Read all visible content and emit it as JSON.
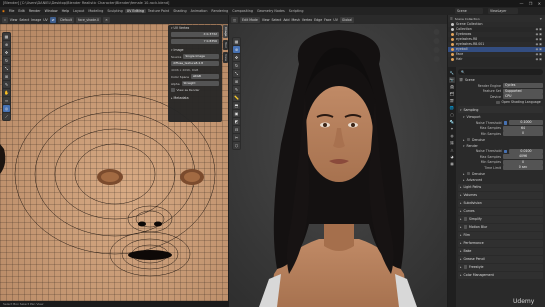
{
  "title_bar": {
    "text": "[Blender] [C:\\Users\\DANIEL\\Desktop\\Blender Realistic Character\\Blender\\female 10-rock.blend]",
    "window_controls": "—  ❐  ✕"
  },
  "menubar": {
    "app_menus": [
      "File",
      "Edit",
      "Render",
      "Window",
      "Help"
    ],
    "workspaces": [
      "Layout",
      "Modeling",
      "Sculpting",
      "UV Editing",
      "Texture Paint",
      "Shading",
      "Animation",
      "Rendering",
      "Compositing",
      "Geometry Nodes",
      "Scripting"
    ],
    "active_workspace": "UV Editing",
    "scene_name": "Scene",
    "view_layer": "ViewLayer"
  },
  "uv_editor": {
    "header_items": [
      "UV Editor",
      "View",
      "Select",
      "Image",
      "UV"
    ],
    "image_name": "face_shade.0",
    "sync_label": "Default",
    "toolbar_icons": [
      "cursor-icon",
      "move-icon",
      "rotate-icon",
      "scale-icon",
      "transform-icon",
      "annotate-icon",
      "grab-icon",
      "relax-icon",
      "pinch-icon",
      "rip-icon"
    ],
    "n_panel": {
      "uv_vertex_section": "UV Vertex",
      "uv_vertex_x": "X  0.3732",
      "uv_vertex_y": "Y  0.8356",
      "image_section": "Image",
      "source_label": "Source",
      "source_value": "Single Image",
      "image_file": "diffuse_texture8.2.8",
      "resolution": "4096 x 4096, RGB",
      "color_space_label": "Color Space",
      "color_space_value": "sRGB",
      "alpha_label": "Alpha",
      "use_as_stereo": "View as Render",
      "metadata_section": "Metadata"
    },
    "side_tabs": [
      "Image",
      "Tool",
      "View"
    ]
  },
  "viewport": {
    "header_items": [
      "Edit Mode",
      "View",
      "Select",
      "Add",
      "Mesh",
      "Vertex",
      "Edge",
      "Face",
      "UV"
    ],
    "orientation": "Global",
    "toolbar_icons": [
      "select-icon",
      "cursor-icon",
      "move-icon",
      "rotate-icon",
      "scale-icon",
      "transform-icon",
      "annotate-icon",
      "measure-icon",
      "extrude-icon",
      "inset-icon",
      "bevel-icon",
      "loopcut-icon",
      "knife-icon",
      "polybuild-icon"
    ],
    "gizmo_icons": [
      "zoom-icon",
      "hand-icon",
      "camera-icon",
      "grid-icon"
    ]
  },
  "outliner": {
    "header": "Scene Collection",
    "items": [
      {
        "name": "Scene Collection",
        "color": "#c8c8c8",
        "selected": false
      },
      {
        "name": "Collection",
        "color": "#c8c8c8",
        "selected": false
      },
      {
        "name": "Eyebrows",
        "color": "#e0a25b",
        "selected": false
      },
      {
        "name": "eyelashes.R8",
        "color": "#e0a25b",
        "selected": false
      },
      {
        "name": "eyelashes.R8.001",
        "color": "#e0a25b",
        "selected": false
      },
      {
        "name": "eyeball",
        "color": "#e0a25b",
        "selected": true
      },
      {
        "name": "Face",
        "color": "#e0a25b",
        "selected": false
      },
      {
        "name": "Hair",
        "color": "#e0a25b",
        "selected": false
      }
    ]
  },
  "properties": {
    "tabs": [
      "tool-icon",
      "render-icon",
      "output-icon",
      "view-layer-icon",
      "scene-icon",
      "world-icon",
      "object-icon",
      "modifier-icon",
      "particles-icon",
      "physics-icon",
      "constraints-icon",
      "data-icon",
      "material-icon",
      "texture-icon"
    ],
    "search_placeholder": "",
    "scene_label": "Scene",
    "render_engine_label": "Render Engine",
    "render_engine_value": "Cycles",
    "feature_set_label": "Feature Set",
    "feature_set_value": "Supported",
    "device_label": "Device",
    "device_value": "CPU",
    "osl_label": "Open Shading Language",
    "sampling_label": "Sampling",
    "viewport_label": "Viewport",
    "noise_threshold_label": "Noise Threshold",
    "noise_threshold_value": "0.1000",
    "max_samples_label": "Max Samples",
    "max_samples_value": "64",
    "min_samples_label": "Min Samples",
    "min_samples_value": "0",
    "denoise_label": "Denoise",
    "render_label": "Render",
    "r_noise_threshold_label": "Noise Threshold",
    "r_noise_threshold_value": "0.0100",
    "r_max_samples_label": "Max Samples",
    "r_max_samples_value": "4096",
    "r_min_samples_label": "Min Samples",
    "r_min_samples_value": "0",
    "time_limit_label": "Time Limit",
    "time_limit_value": "0 sec",
    "r_denoise_label": "Denoise",
    "advanced_label": "Advanced",
    "panels": [
      "Light Paths",
      "Volumes",
      "Subdivision",
      "Curves",
      "Simplify",
      "Motion Blur",
      "Film",
      "Performance",
      "Bake",
      "Grease Pencil",
      "Freestyle",
      "Color Management"
    ]
  },
  "watermark": "Udemy",
  "status_bar": "Select   Box Select   Pan View"
}
